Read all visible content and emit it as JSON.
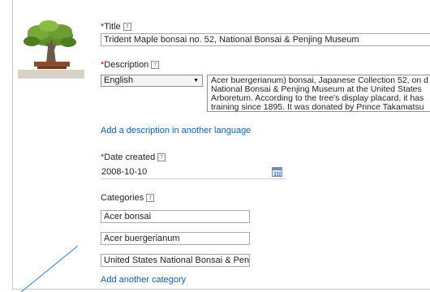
{
  "title": {
    "label": "Title",
    "required_mark": "*",
    "help_glyph": "?",
    "value": "Trident Maple bonsai no. 52, National Bonsai & Penjing Museum"
  },
  "description": {
    "label": "Description",
    "required_mark": "*",
    "help_glyph": "?",
    "language": "English",
    "lines": [
      "Acer buergerianum) bonsai, Japanese Collection 52, on d",
      "National Bonsai & Penjing Museum at the United States",
      "Arboretum. According to the tree's display placard, it has",
      "training since 1895. It was donated by Prince Takamatsu"
    ]
  },
  "add_description_link": "Add a description in another language",
  "date_created": {
    "label": "Date created",
    "required_mark": "*",
    "help_glyph": "?",
    "value": "2008-10-10",
    "calendar_icon": "calendar-icon"
  },
  "categories": {
    "label": "Categories",
    "help_glyph": "?",
    "items": [
      "Acer bonsai",
      "Acer buergerianum",
      "United States National Bonsai & Penjing Museum"
    ]
  },
  "add_category_link": "Add another category",
  "colors": {
    "link": "#0b60b0",
    "required": "#cc0000",
    "border": "#a8a8a8"
  }
}
